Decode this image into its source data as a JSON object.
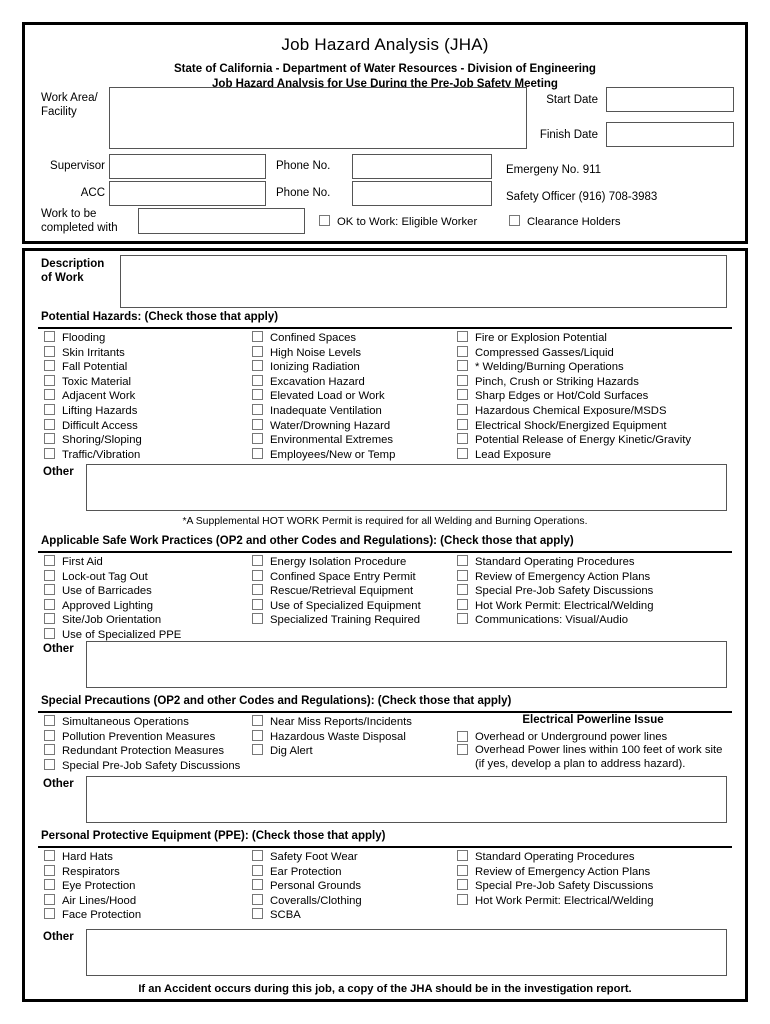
{
  "header": {
    "title": "Job Hazard Analysis (JHA)",
    "subtitle1": "State of California - Department of Water Resources - Division of Engineering",
    "subtitle2": "Job Hazard Analysis for Use During the Pre-Job Safety Meeting",
    "work_area_label_line1": "Work Area/",
    "work_area_label_line2": "Facility",
    "work_area_value": "",
    "start_date_label": "Start Date",
    "start_date_value": "",
    "finish_date_label": "Finish Date",
    "finish_date_value": "",
    "supervisor_label": "Supervisor",
    "supervisor_value": "",
    "supervisor_phone_label": "Phone No.",
    "supervisor_phone_value": "",
    "emergency_text": "Emergeny No. 911",
    "acc_label": "ACC",
    "acc_value": "",
    "acc_phone_label": "Phone No.",
    "acc_phone_value": "",
    "safety_officer_text": "Safety Officer (916) 708-3983",
    "work_with_label_line1": "Work to be",
    "work_with_label_line2": "completed with",
    "work_with_value": "",
    "ok_to_work_label": "OK to Work: Eligible Worker",
    "clearance_holders_label": "Clearance Holders"
  },
  "description": {
    "label_line1": "Description",
    "label_line2": "of Work",
    "value": ""
  },
  "hazards": {
    "heading": "Potential Hazards: (Check those that apply)",
    "col1": [
      "Flooding",
      "Skin Irritants",
      "Fall Potential",
      "Toxic Material",
      "Adjacent Work",
      "Lifting Hazards",
      "Difficult Access",
      "Shoring/Sloping",
      "Traffic/Vibration"
    ],
    "col2": [
      "Confined Spaces",
      "High Noise Levels",
      "Ionizing Radiation",
      "Excavation Hazard",
      "Elevated Load or Work",
      "Inadequate Ventilation",
      "Water/Drowning Hazard",
      "Environmental Extremes",
      "Employees/New or Temp"
    ],
    "col3": [
      "Fire or Explosion Potential",
      "Compressed Gasses/Liquid",
      "* Welding/Burning Operations",
      "Pinch, Crush or Striking Hazards",
      "Sharp Edges or Hot/Cold Surfaces",
      "Hazardous Chemical Exposure/MSDS",
      "Electrical Shock/Energized Equipment",
      "Potential Release of Energy Kinetic/Gravity",
      "Lead Exposure"
    ],
    "other_label": "Other",
    "other_value": "",
    "footnote": "*A Supplemental HOT WORK Permit is required for all Welding and Burning Operations."
  },
  "safe_practices": {
    "heading": "Applicable Safe Work Practices (OP2 and other Codes and Regulations): (Check those that apply)",
    "col1": [
      "First Aid",
      "Lock-out Tag Out",
      "Use of Barricades",
      "Approved Lighting",
      "Site/Job Orientation",
      "Use of Specialized PPE"
    ],
    "col2": [
      "Energy Isolation Procedure",
      "Confined Space Entry Permit",
      "Rescue/Retrieval Equipment",
      "Use of Specialized Equipment",
      "Specialized Training Required"
    ],
    "col3": [
      "Standard Operating Procedures",
      "Review of Emergency Action Plans",
      "Special Pre-Job Safety Discussions",
      "Hot Work Permit: Electrical/Welding",
      "Communications: Visual/Audio"
    ],
    "other_label": "Other",
    "other_value": ""
  },
  "special_precautions": {
    "heading": "Special Precautions (OP2 and other Codes and Regulations): (Check those that apply)",
    "col1": [
      "Simultaneous Operations",
      "Pollution Prevention Measures",
      "Redundant Protection Measures",
      "Special Pre-Job Safety Discussions"
    ],
    "col2": [
      "Near Miss Reports/Incidents",
      "Hazardous Waste Disposal",
      "Dig Alert"
    ],
    "col3_heading": "Electrical Powerline Issue",
    "col3": [
      "Overhead or Underground power lines",
      "Overhead Power lines within 100 feet of work site (if yes, develop a plan to address hazard)."
    ],
    "other_label": "Other",
    "other_value": ""
  },
  "ppe": {
    "heading": "Personal Protective Equipment (PPE): (Check those that apply)",
    "col1": [
      "Hard Hats",
      "Respirators",
      "Eye Protection",
      "Air Lines/Hood",
      "Face Protection"
    ],
    "col2": [
      "Safety Foot Wear",
      "Ear Protection",
      "Personal Grounds",
      "Coveralls/Clothing",
      "SCBA"
    ],
    "col3": [
      "Standard Operating Procedures",
      "Review of Emergency Action Plans",
      "Special Pre-Job Safety Discussions",
      "Hot Work Permit: Electrical/Welding"
    ],
    "other_label": "Other",
    "other_value": ""
  },
  "footer": {
    "text": "If an Accident occurs during this job, a copy of the JHA should be in the investigation report."
  }
}
